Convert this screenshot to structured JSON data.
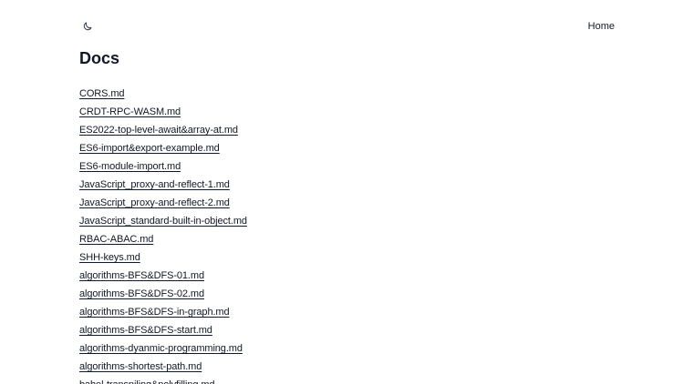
{
  "header": {
    "theme_toggle_icon": "moon-icon",
    "home_label": "Home"
  },
  "page": {
    "title": "Docs"
  },
  "docs": [
    "CORS.md",
    "CRDT-RPC-WASM.md",
    "ES2022-top-level-await&array-at.md",
    "ES6-import&export-example.md",
    "ES6-module-import.md",
    "JavaScript_proxy-and-reflect-1.md",
    "JavaScript_proxy-and-reflect-2.md",
    "JavaScript_standard-built-in-object.md",
    "RBAC-ABAC.md",
    "SHH-keys.md",
    "algorithms-BFS&DFS-01.md",
    "algorithms-BFS&DFS-02.md",
    "algorithms-BFS&DFS-in-graph.md",
    "algorithms-BFS&DFS-start.md",
    "algorithms-dyanmic-programming.md",
    "algorithms-shortest-path.md",
    "babel-transpiling&polyfilling.md"
  ]
}
